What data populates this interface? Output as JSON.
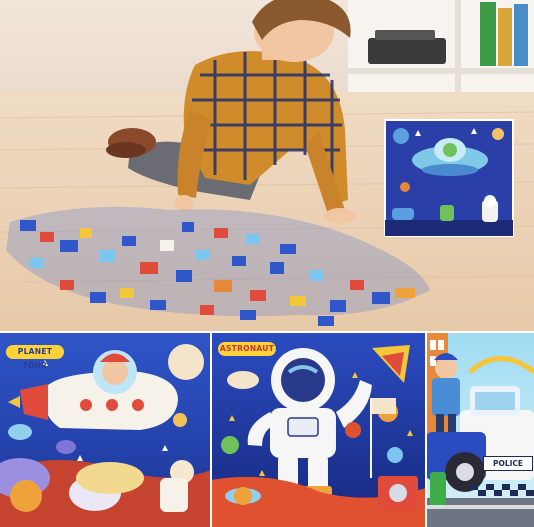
{
  "puzzles": {
    "planet_tour_label": "PLANET TOUR",
    "astronaut_label": "ASTRONAUT",
    "police_label": "POLICE"
  }
}
